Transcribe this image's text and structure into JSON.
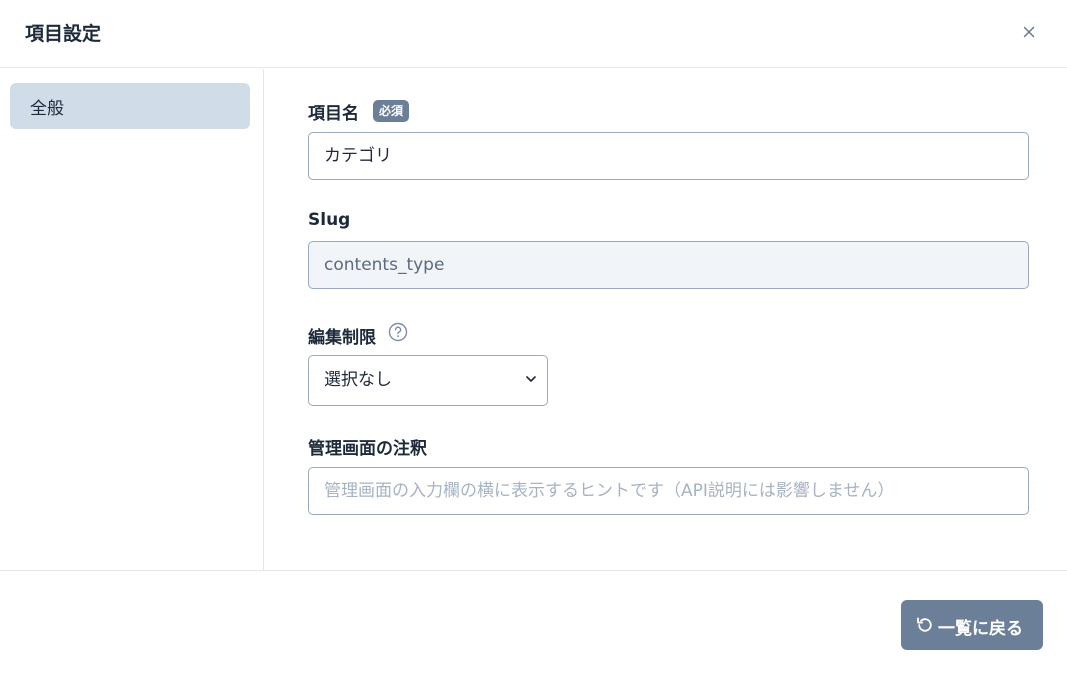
{
  "modal": {
    "title": "項目設定"
  },
  "sidebar": {
    "items": [
      {
        "label": "全般"
      }
    ]
  },
  "form": {
    "name": {
      "label": "項目名",
      "badge": "必須",
      "value": "カテゴリ"
    },
    "slug": {
      "label": "Slug",
      "value": "contents_type"
    },
    "edit_restriction": {
      "label": "編集制限",
      "selected": "選択なし"
    },
    "admin_note": {
      "label": "管理画面の注釈",
      "placeholder": "管理画面の入力欄の横に表示するヒントです（API説明には影響しません）"
    }
  },
  "footer": {
    "back_label": "一覧に戻る"
  },
  "colors": {
    "accent": "#6b7f99",
    "sidebar_active": "#d1dce9",
    "border": "#9aa9bb"
  },
  "icons": {
    "close": "close-icon",
    "help": "question-circle-icon",
    "select": "chevron-down-icon",
    "back": "undo-icon"
  }
}
